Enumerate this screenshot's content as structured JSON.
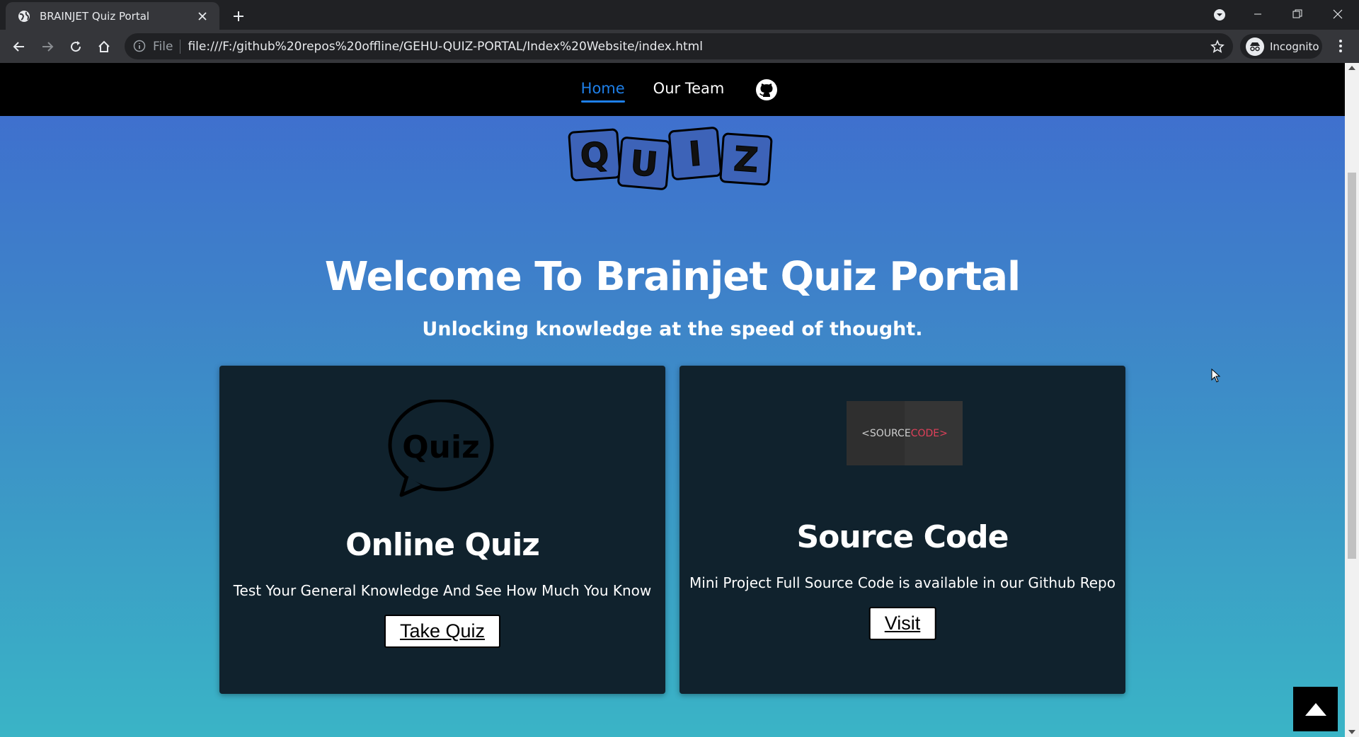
{
  "browser": {
    "tab_title": "BRAINJET Quiz Portal",
    "omnibox_scheme": "File",
    "url": "file:///F:/github%20repos%20offline/GEHU-QUIZ-PORTAL/Index%20Website/index.html",
    "profile_label": "Incognito"
  },
  "nav": {
    "home": "Home",
    "team": "Our Team"
  },
  "logo": {
    "letters": [
      "Q",
      "U",
      "I",
      "Z"
    ]
  },
  "hero": {
    "title": "Welcome To Brainjet Quiz Portal",
    "subtitle": "Unlocking knowledge at the speed of thought."
  },
  "cards": [
    {
      "icon_text": "Quiz",
      "title": "Online Quiz",
      "description": "Test Your General Knowledge And See How Much You Know",
      "button": "Take Quiz"
    },
    {
      "image_text_a": "<SOURCE",
      "image_text_b": "CODE>",
      "title": "Source Code",
      "description": "Mini Project Full Source Code is available in our Github Repo",
      "button": "Visit"
    }
  ],
  "colors": {
    "nav_active": "#1e7fe8",
    "card_bg": "#10222d",
    "gradient_top": "#3f6bcf",
    "gradient_bottom": "#3ab4c6"
  }
}
